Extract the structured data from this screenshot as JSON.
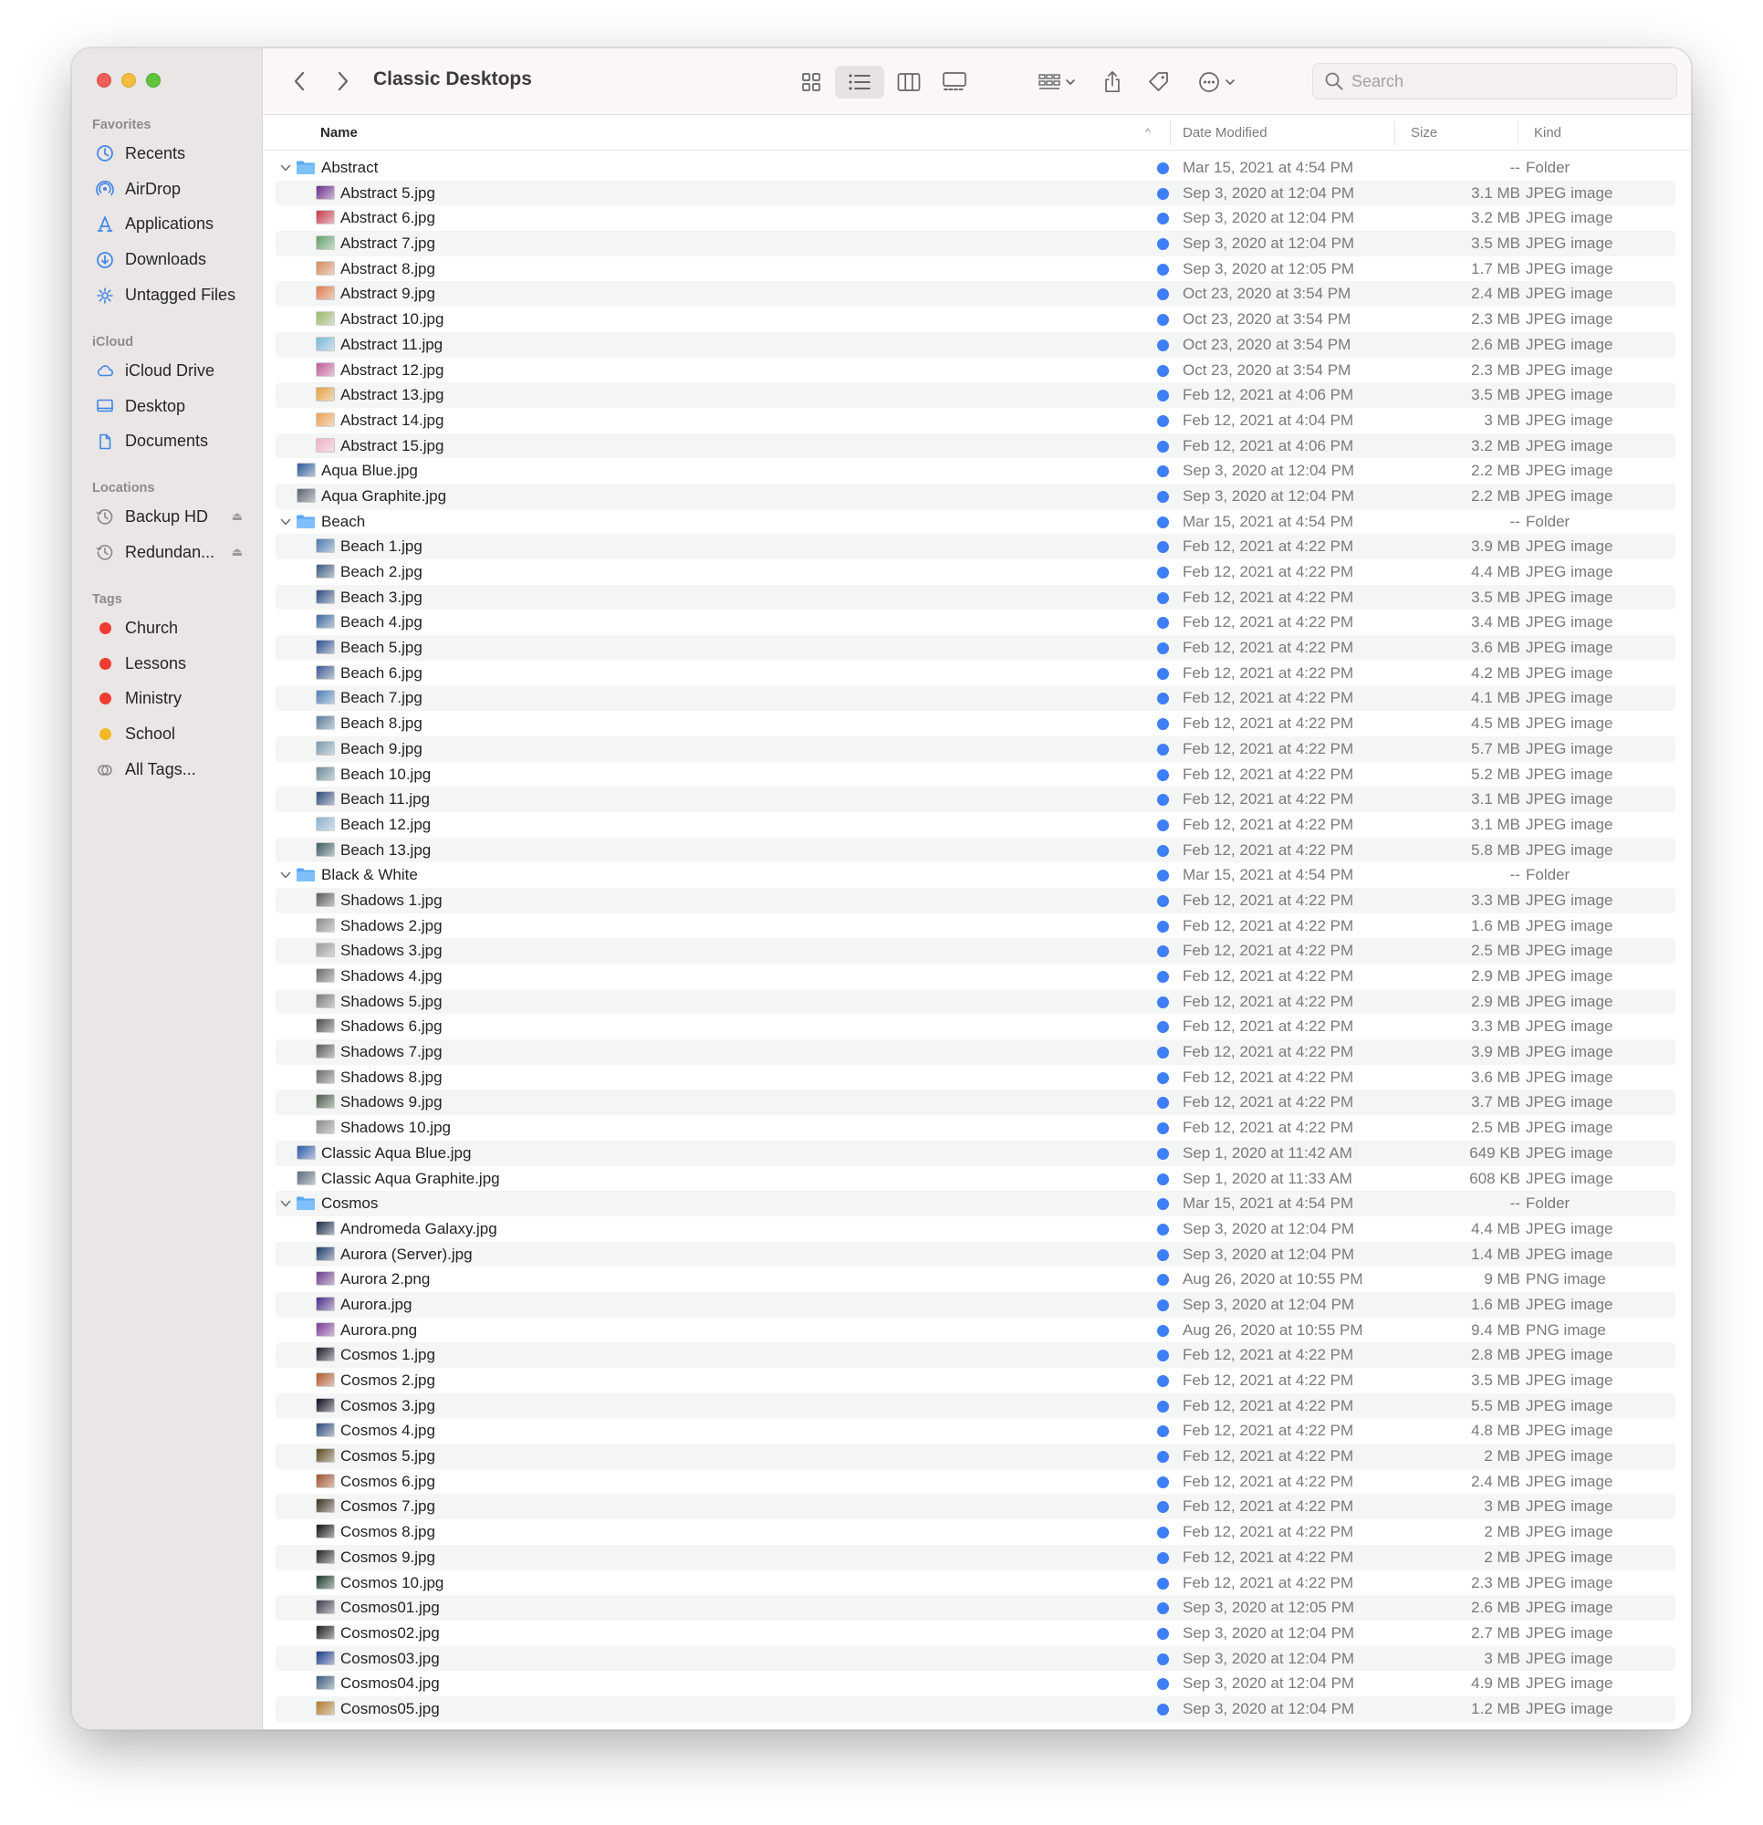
{
  "window": {
    "title": "Classic Desktops",
    "search_placeholder": "Search"
  },
  "colors": {
    "tag_red": "#ee3c33",
    "tag_yellow": "#f3b923",
    "accent_blue": "#3e7ef6",
    "folder_blue": "#5ba8f2"
  },
  "sidebar": {
    "favorites_header": "Favorites",
    "favorites": [
      {
        "label": "Recents",
        "icon": "clock-icon"
      },
      {
        "label": "AirDrop",
        "icon": "airdrop-icon"
      },
      {
        "label": "Applications",
        "icon": "applications-icon"
      },
      {
        "label": "Downloads",
        "icon": "downloads-icon"
      },
      {
        "label": "Untagged Files",
        "icon": "gear-icon"
      }
    ],
    "icloud_header": "iCloud",
    "icloud": [
      {
        "label": "iCloud Drive",
        "icon": "cloud-icon"
      },
      {
        "label": "Desktop",
        "icon": "desktop-icon"
      },
      {
        "label": "Documents",
        "icon": "document-icon"
      }
    ],
    "locations_header": "Locations",
    "locations": [
      {
        "label": "Backup HD",
        "icon": "time-machine-icon"
      },
      {
        "label": "Redundan...",
        "icon": "time-machine-icon"
      }
    ],
    "tags_header": "Tags",
    "tags": [
      {
        "label": "Church",
        "color": "#ee3c33"
      },
      {
        "label": "Lessons",
        "color": "#ee3c33"
      },
      {
        "label": "Ministry",
        "color": "#ee3c33"
      },
      {
        "label": "School",
        "color": "#f3b923"
      },
      {
        "label": "All Tags...",
        "color": ""
      }
    ]
  },
  "columns": {
    "name": "Name",
    "date": "Date Modified",
    "size": "Size",
    "kind": "Kind"
  },
  "files": [
    {
      "name": "Abstract",
      "date": "Mar 15, 2021 at 4:54 PM",
      "size": "--",
      "kind": "Folder",
      "folder": true,
      "level": 0,
      "thumb": "#5ba8f2"
    },
    {
      "name": "Abstract 5.jpg",
      "date": "Sep 3, 2020 at 12:04 PM",
      "size": "3.1 MB",
      "kind": "JPEG image",
      "folder": false,
      "level": 1,
      "thumb": "#6a2a8a"
    },
    {
      "name": "Abstract 6.jpg",
      "date": "Sep 3, 2020 at 12:04 PM",
      "size": "3.2 MB",
      "kind": "JPEG image",
      "folder": false,
      "level": 1,
      "thumb": "#c8384a"
    },
    {
      "name": "Abstract 7.jpg",
      "date": "Sep 3, 2020 at 12:04 PM",
      "size": "3.5 MB",
      "kind": "JPEG image",
      "folder": false,
      "level": 1,
      "thumb": "#5fa06a"
    },
    {
      "name": "Abstract 8.jpg",
      "date": "Sep 3, 2020 at 12:05 PM",
      "size": "1.7 MB",
      "kind": "JPEG image",
      "folder": false,
      "level": 1,
      "thumb": "#d88a5a"
    },
    {
      "name": "Abstract 9.jpg",
      "date": "Oct 23, 2020 at 3:54 PM",
      "size": "2.4 MB",
      "kind": "JPEG image",
      "folder": false,
      "level": 1,
      "thumb": "#e07a4a"
    },
    {
      "name": "Abstract 10.jpg",
      "date": "Oct 23, 2020 at 3:54 PM",
      "size": "2.3 MB",
      "kind": "JPEG image",
      "folder": false,
      "level": 1,
      "thumb": "#9ab86a"
    },
    {
      "name": "Abstract 11.jpg",
      "date": "Oct 23, 2020 at 3:54 PM",
      "size": "2.6 MB",
      "kind": "JPEG image",
      "folder": false,
      "level": 1,
      "thumb": "#7ab8d8"
    },
    {
      "name": "Abstract 12.jpg",
      "date": "Oct 23, 2020 at 3:54 PM",
      "size": "2.3 MB",
      "kind": "JPEG image",
      "folder": false,
      "level": 1,
      "thumb": "#c05a9a"
    },
    {
      "name": "Abstract 13.jpg",
      "date": "Feb 12, 2021 at 4:06 PM",
      "size": "3.5 MB",
      "kind": "JPEG image",
      "folder": false,
      "level": 1,
      "thumb": "#e8a040"
    },
    {
      "name": "Abstract 14.jpg",
      "date": "Feb 12, 2021 at 4:04 PM",
      "size": "3 MB",
      "kind": "JPEG image",
      "folder": false,
      "level": 1,
      "thumb": "#f0a050"
    },
    {
      "name": "Abstract 15.jpg",
      "date": "Feb 12, 2021 at 4:06 PM",
      "size": "3.2 MB",
      "kind": "JPEG image",
      "folder": false,
      "level": 1,
      "thumb": "#f0b0c8"
    },
    {
      "name": "Aqua Blue.jpg",
      "date": "Sep 3, 2020 at 12:04 PM",
      "size": "2.2 MB",
      "kind": "JPEG image",
      "folder": false,
      "level": 0,
      "thumb": "#2a5a9a"
    },
    {
      "name": "Aqua Graphite.jpg",
      "date": "Sep 3, 2020 at 12:04 PM",
      "size": "2.2 MB",
      "kind": "JPEG image",
      "folder": false,
      "level": 0,
      "thumb": "#5a6270"
    },
    {
      "name": "Beach",
      "date": "Mar 15, 2021 at 4:54 PM",
      "size": "--",
      "kind": "Folder",
      "folder": true,
      "level": 0,
      "thumb": "#5ba8f2"
    },
    {
      "name": "Beach 1.jpg",
      "date": "Feb 12, 2021 at 4:22 PM",
      "size": "3.9 MB",
      "kind": "JPEG image",
      "folder": false,
      "level": 1,
      "thumb": "#4a7ab0"
    },
    {
      "name": "Beach 2.jpg",
      "date": "Feb 12, 2021 at 4:22 PM",
      "size": "4.4 MB",
      "kind": "JPEG image",
      "folder": false,
      "level": 1,
      "thumb": "#3a5a80"
    },
    {
      "name": "Beach 3.jpg",
      "date": "Feb 12, 2021 at 4:22 PM",
      "size": "3.5 MB",
      "kind": "JPEG image",
      "folder": false,
      "level": 1,
      "thumb": "#2a4a80"
    },
    {
      "name": "Beach 4.jpg",
      "date": "Feb 12, 2021 at 4:22 PM",
      "size": "3.4 MB",
      "kind": "JPEG image",
      "folder": false,
      "level": 1,
      "thumb": "#3a6aa0"
    },
    {
      "name": "Beach 5.jpg",
      "date": "Feb 12, 2021 at 4:22 PM",
      "size": "3.6 MB",
      "kind": "JPEG image",
      "folder": false,
      "level": 1,
      "thumb": "#2a5090"
    },
    {
      "name": "Beach 6.jpg",
      "date": "Feb 12, 2021 at 4:22 PM",
      "size": "4.2 MB",
      "kind": "JPEG image",
      "folder": false,
      "level": 1,
      "thumb": "#3a5a90"
    },
    {
      "name": "Beach 7.jpg",
      "date": "Feb 12, 2021 at 4:22 PM",
      "size": "4.1 MB",
      "kind": "JPEG image",
      "folder": false,
      "level": 1,
      "thumb": "#4a80b8"
    },
    {
      "name": "Beach 8.jpg",
      "date": "Feb 12, 2021 at 4:22 PM",
      "size": "4.5 MB",
      "kind": "JPEG image",
      "folder": false,
      "level": 1,
      "thumb": "#5a7a9a"
    },
    {
      "name": "Beach 9.jpg",
      "date": "Feb 12, 2021 at 4:22 PM",
      "size": "5.7 MB",
      "kind": "JPEG image",
      "folder": false,
      "level": 1,
      "thumb": "#7a9ab0"
    },
    {
      "name": "Beach 10.jpg",
      "date": "Feb 12, 2021 at 4:22 PM",
      "size": "5.2 MB",
      "kind": "JPEG image",
      "folder": false,
      "level": 1,
      "thumb": "#6a8a9a"
    },
    {
      "name": "Beach 11.jpg",
      "date": "Feb 12, 2021 at 4:22 PM",
      "size": "3.1 MB",
      "kind": "JPEG image",
      "folder": false,
      "level": 1,
      "thumb": "#2a4a78"
    },
    {
      "name": "Beach 12.jpg",
      "date": "Feb 12, 2021 at 4:22 PM",
      "size": "3.1 MB",
      "kind": "JPEG image",
      "folder": false,
      "level": 1,
      "thumb": "#8ab0d0"
    },
    {
      "name": "Beach 13.jpg",
      "date": "Feb 12, 2021 at 4:22 PM",
      "size": "5.8 MB",
      "kind": "JPEG image",
      "folder": false,
      "level": 1,
      "thumb": "#3a5a60"
    },
    {
      "name": "Black & White",
      "date": "Mar 15, 2021 at 4:54 PM",
      "size": "--",
      "kind": "Folder",
      "folder": true,
      "level": 0,
      "thumb": "#5ba8f2"
    },
    {
      "name": "Shadows 1.jpg",
      "date": "Feb 12, 2021 at 4:22 PM",
      "size": "3.3 MB",
      "kind": "JPEG image",
      "folder": false,
      "level": 1,
      "thumb": "#5a5a5a"
    },
    {
      "name": "Shadows 2.jpg",
      "date": "Feb 12, 2021 at 4:22 PM",
      "size": "1.6 MB",
      "kind": "JPEG image",
      "folder": false,
      "level": 1,
      "thumb": "#8a8a8a"
    },
    {
      "name": "Shadows 3.jpg",
      "date": "Feb 12, 2021 at 4:22 PM",
      "size": "2.5 MB",
      "kind": "JPEG image",
      "folder": false,
      "level": 1,
      "thumb": "#9a9a9a"
    },
    {
      "name": "Shadows 4.jpg",
      "date": "Feb 12, 2021 at 4:22 PM",
      "size": "2.9 MB",
      "kind": "JPEG image",
      "folder": false,
      "level": 1,
      "thumb": "#6a6a6a"
    },
    {
      "name": "Shadows 5.jpg",
      "date": "Feb 12, 2021 at 4:22 PM",
      "size": "2.9 MB",
      "kind": "JPEG image",
      "folder": false,
      "level": 1,
      "thumb": "#7a7a7a"
    },
    {
      "name": "Shadows 6.jpg",
      "date": "Feb 12, 2021 at 4:22 PM",
      "size": "3.3 MB",
      "kind": "JPEG image",
      "folder": false,
      "level": 1,
      "thumb": "#4a4a4a"
    },
    {
      "name": "Shadows 7.jpg",
      "date": "Feb 12, 2021 at 4:22 PM",
      "size": "3.9 MB",
      "kind": "JPEG image",
      "folder": false,
      "level": 1,
      "thumb": "#5a5a5a"
    },
    {
      "name": "Shadows 8.jpg",
      "date": "Feb 12, 2021 at 4:22 PM",
      "size": "3.6 MB",
      "kind": "JPEG image",
      "folder": false,
      "level": 1,
      "thumb": "#6a6a6a"
    },
    {
      "name": "Shadows 9.jpg",
      "date": "Feb 12, 2021 at 4:22 PM",
      "size": "3.7 MB",
      "kind": "JPEG image",
      "folder": false,
      "level": 1,
      "thumb": "#4a5a4a"
    },
    {
      "name": "Shadows 10.jpg",
      "date": "Feb 12, 2021 at 4:22 PM",
      "size": "2.5 MB",
      "kind": "JPEG image",
      "folder": false,
      "level": 1,
      "thumb": "#8a8a8a"
    },
    {
      "name": "Classic Aqua Blue.jpg",
      "date": "Sep 1, 2020 at 11:42 AM",
      "size": "649 KB",
      "kind": "JPEG image",
      "folder": false,
      "level": 0,
      "thumb": "#2a5aa8"
    },
    {
      "name": "Classic Aqua Graphite.jpg",
      "date": "Sep 1, 2020 at 11:33 AM",
      "size": "608 KB",
      "kind": "JPEG image",
      "folder": false,
      "level": 0,
      "thumb": "#5a6a7a"
    },
    {
      "name": "Cosmos",
      "date": "Mar 15, 2021 at 4:54 PM",
      "size": "--",
      "kind": "Folder",
      "folder": true,
      "level": 0,
      "thumb": "#5ba8f2"
    },
    {
      "name": "Andromeda Galaxy.jpg",
      "date": "Sep 3, 2020 at 12:04 PM",
      "size": "4.4 MB",
      "kind": "JPEG image",
      "folder": false,
      "level": 1,
      "thumb": "#1a2a4a"
    },
    {
      "name": "Aurora (Server).jpg",
      "date": "Sep 3, 2020 at 12:04 PM",
      "size": "1.4 MB",
      "kind": "JPEG image",
      "folder": false,
      "level": 1,
      "thumb": "#1a3a6a"
    },
    {
      "name": "Aurora 2.png",
      "date": "Aug 26, 2020 at 10:55 PM",
      "size": "9 MB",
      "kind": "PNG image",
      "folder": false,
      "level": 1,
      "thumb": "#6a3a8a"
    },
    {
      "name": "Aurora.jpg",
      "date": "Sep 3, 2020 at 12:04 PM",
      "size": "1.6 MB",
      "kind": "JPEG image",
      "folder": false,
      "level": 1,
      "thumb": "#4a2a8a"
    },
    {
      "name": "Aurora.png",
      "date": "Aug 26, 2020 at 10:55 PM",
      "size": "9.4 MB",
      "kind": "PNG image",
      "folder": false,
      "level": 1,
      "thumb": "#7a3a9a"
    },
    {
      "name": "Cosmos 1.jpg",
      "date": "Feb 12, 2021 at 4:22 PM",
      "size": "2.8 MB",
      "kind": "JPEG image",
      "folder": false,
      "level": 1,
      "thumb": "#1a1a2a"
    },
    {
      "name": "Cosmos 2.jpg",
      "date": "Feb 12, 2021 at 4:22 PM",
      "size": "3.5 MB",
      "kind": "JPEG image",
      "folder": false,
      "level": 1,
      "thumb": "#b05a2a"
    },
    {
      "name": "Cosmos 3.jpg",
      "date": "Feb 12, 2021 at 4:22 PM",
      "size": "5.5 MB",
      "kind": "JPEG image",
      "folder": false,
      "level": 1,
      "thumb": "#0a0a1a"
    },
    {
      "name": "Cosmos 4.jpg",
      "date": "Feb 12, 2021 at 4:22 PM",
      "size": "4.8 MB",
      "kind": "JPEG image",
      "folder": false,
      "level": 1,
      "thumb": "#2a4a7a"
    },
    {
      "name": "Cosmos 5.jpg",
      "date": "Feb 12, 2021 at 4:22 PM",
      "size": "2 MB",
      "kind": "JPEG image",
      "folder": false,
      "level": 1,
      "thumb": "#5a4a1a"
    },
    {
      "name": "Cosmos 6.jpg",
      "date": "Feb 12, 2021 at 4:22 PM",
      "size": "2.4 MB",
      "kind": "JPEG image",
      "folder": false,
      "level": 1,
      "thumb": "#a0502a"
    },
    {
      "name": "Cosmos 7.jpg",
      "date": "Feb 12, 2021 at 4:22 PM",
      "size": "3 MB",
      "kind": "JPEG image",
      "folder": false,
      "level": 1,
      "thumb": "#3a3020"
    },
    {
      "name": "Cosmos 8.jpg",
      "date": "Feb 12, 2021 at 4:22 PM",
      "size": "2 MB",
      "kind": "JPEG image",
      "folder": false,
      "level": 1,
      "thumb": "#101010"
    },
    {
      "name": "Cosmos 9.jpg",
      "date": "Feb 12, 2021 at 4:22 PM",
      "size": "2 MB",
      "kind": "JPEG image",
      "folder": false,
      "level": 1,
      "thumb": "#202020"
    },
    {
      "name": "Cosmos 10.jpg",
      "date": "Feb 12, 2021 at 4:22 PM",
      "size": "2.3 MB",
      "kind": "JPEG image",
      "folder": false,
      "level": 1,
      "thumb": "#1a3a2a"
    },
    {
      "name": "Cosmos01.jpg",
      "date": "Sep 3, 2020 at 12:05 PM",
      "size": "2.6 MB",
      "kind": "JPEG image",
      "folder": false,
      "level": 1,
      "thumb": "#3a3a4a"
    },
    {
      "name": "Cosmos02.jpg",
      "date": "Sep 3, 2020 at 12:04 PM",
      "size": "2.7 MB",
      "kind": "JPEG image",
      "folder": false,
      "level": 1,
      "thumb": "#1a1a1a"
    },
    {
      "name": "Cosmos03.jpg",
      "date": "Sep 3, 2020 at 12:04 PM",
      "size": "3 MB",
      "kind": "JPEG image",
      "folder": false,
      "level": 1,
      "thumb": "#1a3a8a"
    },
    {
      "name": "Cosmos04.jpg",
      "date": "Sep 3, 2020 at 12:04 PM",
      "size": "4.9 MB",
      "kind": "JPEG image",
      "folder": false,
      "level": 1,
      "thumb": "#3a5a7a"
    },
    {
      "name": "Cosmos05.jpg",
      "date": "Sep 3, 2020 at 12:04 PM",
      "size": "1.2 MB",
      "kind": "JPEG image",
      "folder": false,
      "level": 1,
      "thumb": "#b07a2a"
    }
  ]
}
